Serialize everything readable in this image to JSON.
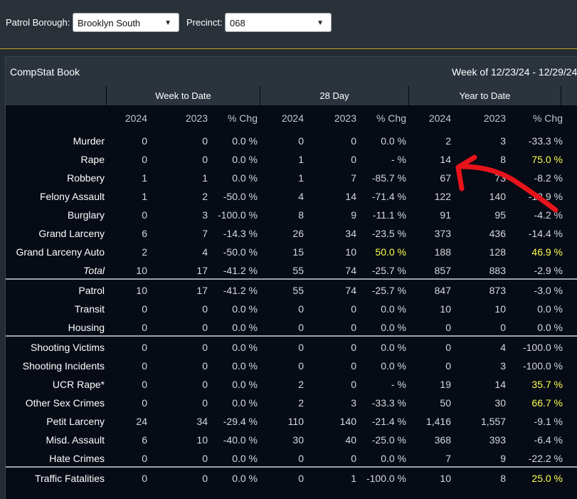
{
  "filters": {
    "patrol_borough_label": "Patrol Borough:",
    "patrol_borough_value": "Brooklyn South",
    "precinct_label": "Precinct:",
    "precinct_value": "068"
  },
  "panel": {
    "title": "CompStat Book",
    "week_range": "Week of 12/23/24 - 12/29/24"
  },
  "groups": [
    "Week to Date",
    "28 Day",
    "Year to Date"
  ],
  "columns": [
    "2024",
    "2023",
    "% Chg",
    "2024",
    "2023",
    "% Chg",
    "2024",
    "2023",
    "% Chg"
  ],
  "highlight_color": "#ffff4d",
  "annotation": {
    "type": "red-arrow",
    "color": "#e8141b",
    "points_to": "Rape Year to Date 2024 value"
  },
  "sections": [
    [
      {
        "label": "Murder",
        "values": [
          "0",
          "0",
          "0.0 %",
          "0",
          "0",
          "0.0 %",
          "2",
          "3",
          "-33.3 %"
        ],
        "hl": []
      },
      {
        "label": "Rape",
        "values": [
          "0",
          "0",
          "0.0 %",
          "1",
          "0",
          "- %",
          "14",
          "8",
          "75.0 %"
        ],
        "hl": [
          8
        ]
      },
      {
        "label": "Robbery",
        "values": [
          "1",
          "1",
          "0.0 %",
          "1",
          "7",
          "-85.7 %",
          "67",
          "73",
          "-8.2 %"
        ],
        "hl": []
      },
      {
        "label": "Felony Assault",
        "values": [
          "1",
          "2",
          "-50.0 %",
          "4",
          "14",
          "-71.4 %",
          "122",
          "140",
          "-12.9 %"
        ],
        "hl": []
      },
      {
        "label": "Burglary",
        "values": [
          "0",
          "3",
          "-100.0 %",
          "8",
          "9",
          "-11.1 %",
          "91",
          "95",
          "-4.2 %"
        ],
        "hl": []
      },
      {
        "label": "Grand Larceny",
        "values": [
          "6",
          "7",
          "-14.3 %",
          "26",
          "34",
          "-23.5 %",
          "373",
          "436",
          "-14.4 %"
        ],
        "hl": []
      },
      {
        "label": "Grand Larceny Auto",
        "values": [
          "2",
          "4",
          "-50.0 %",
          "15",
          "10",
          "50.0 %",
          "188",
          "128",
          "46.9 %"
        ],
        "hl": [
          5,
          8
        ]
      },
      {
        "label": "Total",
        "values": [
          "10",
          "17",
          "-41.2 %",
          "55",
          "74",
          "-25.7 %",
          "857",
          "883",
          "-2.9 %"
        ],
        "hl": [],
        "italic": true
      }
    ],
    [
      {
        "label": "Patrol",
        "values": [
          "10",
          "17",
          "-41.2 %",
          "55",
          "74",
          "-25.7 %",
          "847",
          "873",
          "-3.0 %"
        ],
        "hl": []
      },
      {
        "label": "Transit",
        "values": [
          "0",
          "0",
          "0.0 %",
          "0",
          "0",
          "0.0 %",
          "10",
          "10",
          "0.0 %"
        ],
        "hl": []
      },
      {
        "label": "Housing",
        "values": [
          "0",
          "0",
          "0.0 %",
          "0",
          "0",
          "0.0 %",
          "0",
          "0",
          "0.0 %"
        ],
        "hl": []
      }
    ],
    [
      {
        "label": "Shooting Victims",
        "values": [
          "0",
          "0",
          "0.0 %",
          "0",
          "0",
          "0.0 %",
          "0",
          "4",
          "-100.0 %"
        ],
        "hl": []
      },
      {
        "label": "Shooting Incidents",
        "values": [
          "0",
          "0",
          "0.0 %",
          "0",
          "0",
          "0.0 %",
          "0",
          "3",
          "-100.0 %"
        ],
        "hl": []
      },
      {
        "label": "UCR Rape*",
        "values": [
          "0",
          "0",
          "0.0 %",
          "2",
          "0",
          "- %",
          "19",
          "14",
          "35.7 %"
        ],
        "hl": [
          8
        ]
      },
      {
        "label": "Other Sex Crimes",
        "values": [
          "0",
          "0",
          "0.0 %",
          "2",
          "3",
          "-33.3 %",
          "50",
          "30",
          "66.7 %"
        ],
        "hl": [
          8
        ]
      },
      {
        "label": "Petit Larceny",
        "values": [
          "24",
          "34",
          "-29.4 %",
          "110",
          "140",
          "-21.4 %",
          "1,416",
          "1,557",
          "-9.1 %"
        ],
        "hl": []
      },
      {
        "label": "Misd. Assault",
        "values": [
          "6",
          "10",
          "-40.0 %",
          "30",
          "40",
          "-25.0 %",
          "368",
          "393",
          "-6.4 %"
        ],
        "hl": []
      },
      {
        "label": "Hate Crimes",
        "values": [
          "0",
          "0",
          "0.0 %",
          "0",
          "0",
          "0.0 %",
          "7",
          "9",
          "-22.2 %"
        ],
        "hl": []
      }
    ],
    [
      {
        "label": "Traffic Fatalities",
        "values": [
          "0",
          "0",
          "0.0 %",
          "0",
          "1",
          "-100.0 %",
          "10",
          "8",
          "25.0 %"
        ],
        "hl": [
          8
        ]
      }
    ]
  ]
}
